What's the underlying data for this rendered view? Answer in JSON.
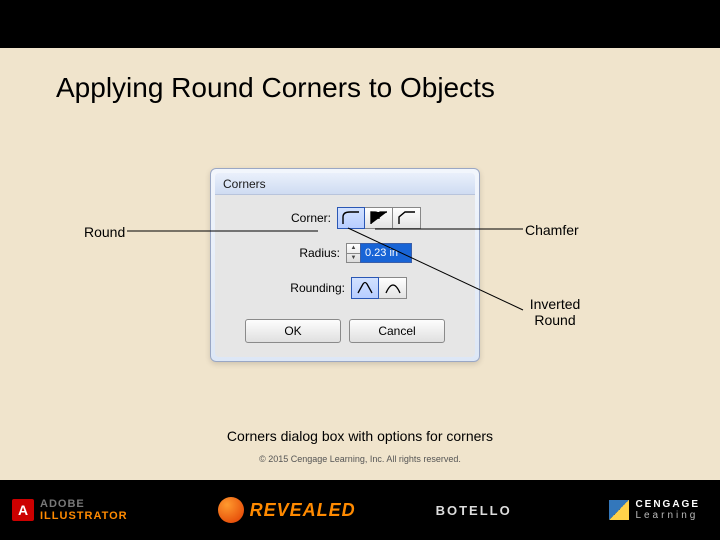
{
  "slide": {
    "title": "Applying Round Corners to Objects",
    "caption": "Corners dialog box with options for corners",
    "copyright": "© 2015 Cengage Learning, Inc. All rights reserved."
  },
  "dialog": {
    "title": "Corners",
    "corner_label": "Corner:",
    "radius_label": "Radius:",
    "rounding_label": "Rounding:",
    "radius_value": "0.23 in",
    "ok": "OK",
    "cancel": "Cancel"
  },
  "annotations": {
    "round": "Round",
    "chamfer": "Chamfer",
    "inverted_round_line1": "Inverted",
    "inverted_round_line2": "Round"
  },
  "footer": {
    "adobe_top": "ADOBE",
    "adobe_bottom": "ILLUSTRATOR",
    "revealed": "REVEALED",
    "author": "BOTELLO",
    "cengage_top": "CENGAGE",
    "cengage_bottom": "Learning"
  }
}
